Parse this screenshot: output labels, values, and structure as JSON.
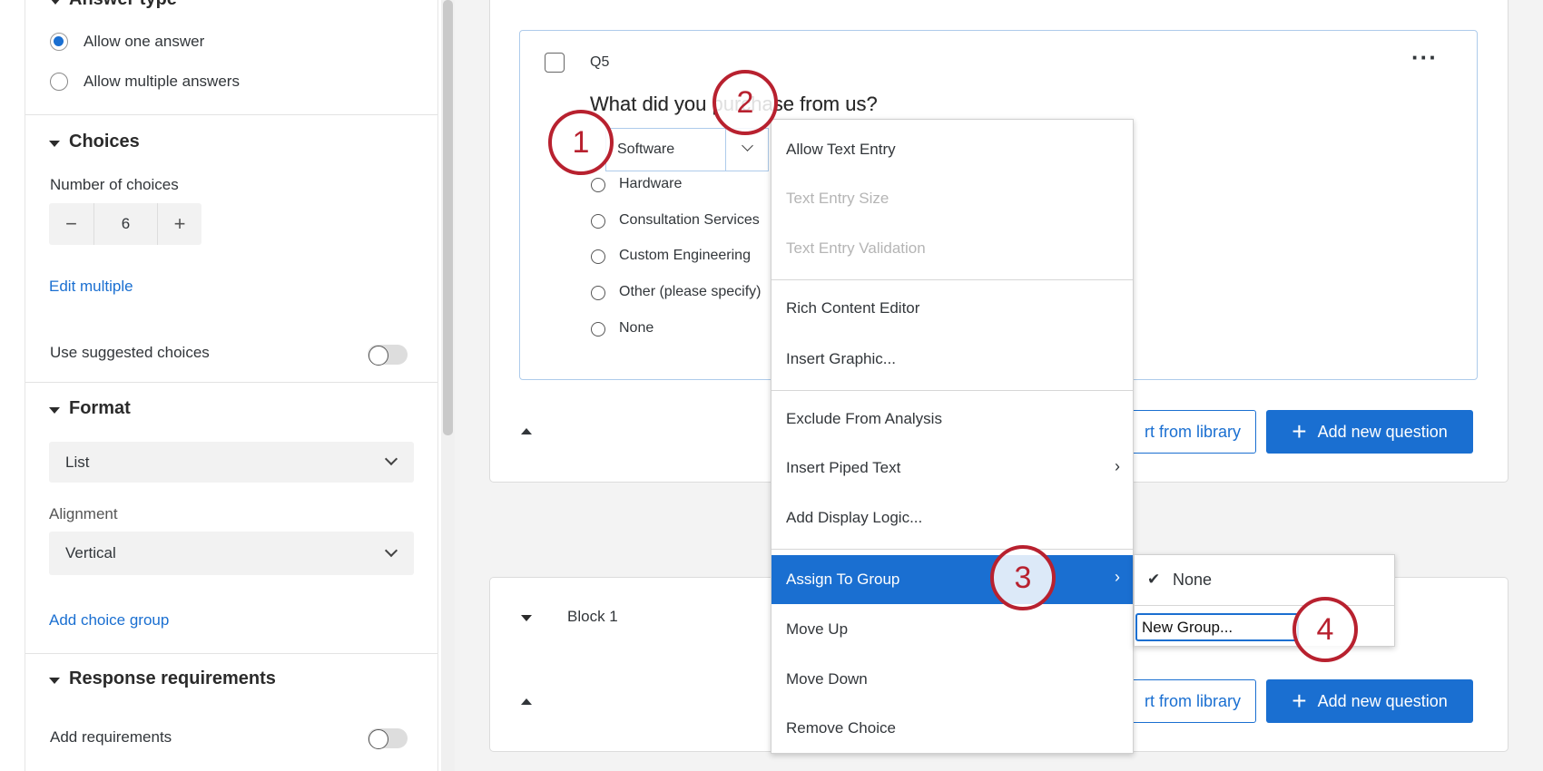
{
  "left_panel": {
    "answer_type": {
      "heading": "Answer type",
      "options": [
        "Allow one answer",
        "Allow multiple answers"
      ],
      "selected": 0
    },
    "choices": {
      "heading": "Choices",
      "number_label": "Number of choices",
      "number_value": "6",
      "edit_multiple": "Edit multiple",
      "suggested_label": "Use suggested choices",
      "suggested_on": false
    },
    "format": {
      "heading": "Format",
      "format_value": "List",
      "alignment_label": "Alignment",
      "alignment_value": "Vertical",
      "add_group": "Add choice group"
    },
    "response": {
      "heading": "Response requirements",
      "add_label": "Add requirements",
      "add_on": false
    }
  },
  "question": {
    "id": "Q5",
    "text": "What did you purchase from us?",
    "text_before": "What did you",
    "text_after": "ase from us?",
    "choices": [
      "Software",
      "Hardware",
      "Consultation Services",
      "Custom Engineering",
      "Other (please specify)",
      "None"
    ]
  },
  "buttons": {
    "import": "rt from library",
    "add": "Add new question"
  },
  "block": {
    "title": "Block 1"
  },
  "context_menu": {
    "items": [
      {
        "label": "Allow Text Entry",
        "disabled": false
      },
      {
        "label": "Text Entry Size",
        "disabled": true
      },
      {
        "label": "Text Entry Validation",
        "disabled": true
      },
      {
        "label": "Rich Content Editor",
        "disabled": false
      },
      {
        "label": "Insert Graphic...",
        "disabled": false
      },
      {
        "label": "Exclude From Analysis",
        "disabled": false
      },
      {
        "label": "Insert Piped Text",
        "disabled": false,
        "submenu": true
      },
      {
        "label": "Add Display Logic...",
        "disabled": false
      },
      {
        "label": "Assign To Group",
        "highlighted": true,
        "submenu": true
      },
      {
        "label": "Move Up"
      },
      {
        "label": "Move Down"
      },
      {
        "label": "Remove Choice"
      }
    ]
  },
  "submenu": {
    "none": "None",
    "new_group": "New Group..."
  },
  "annotations": [
    "1",
    "2",
    "3",
    "4"
  ],
  "colors": {
    "accent": "#1a6fd1",
    "annotation": "#b8212f"
  }
}
